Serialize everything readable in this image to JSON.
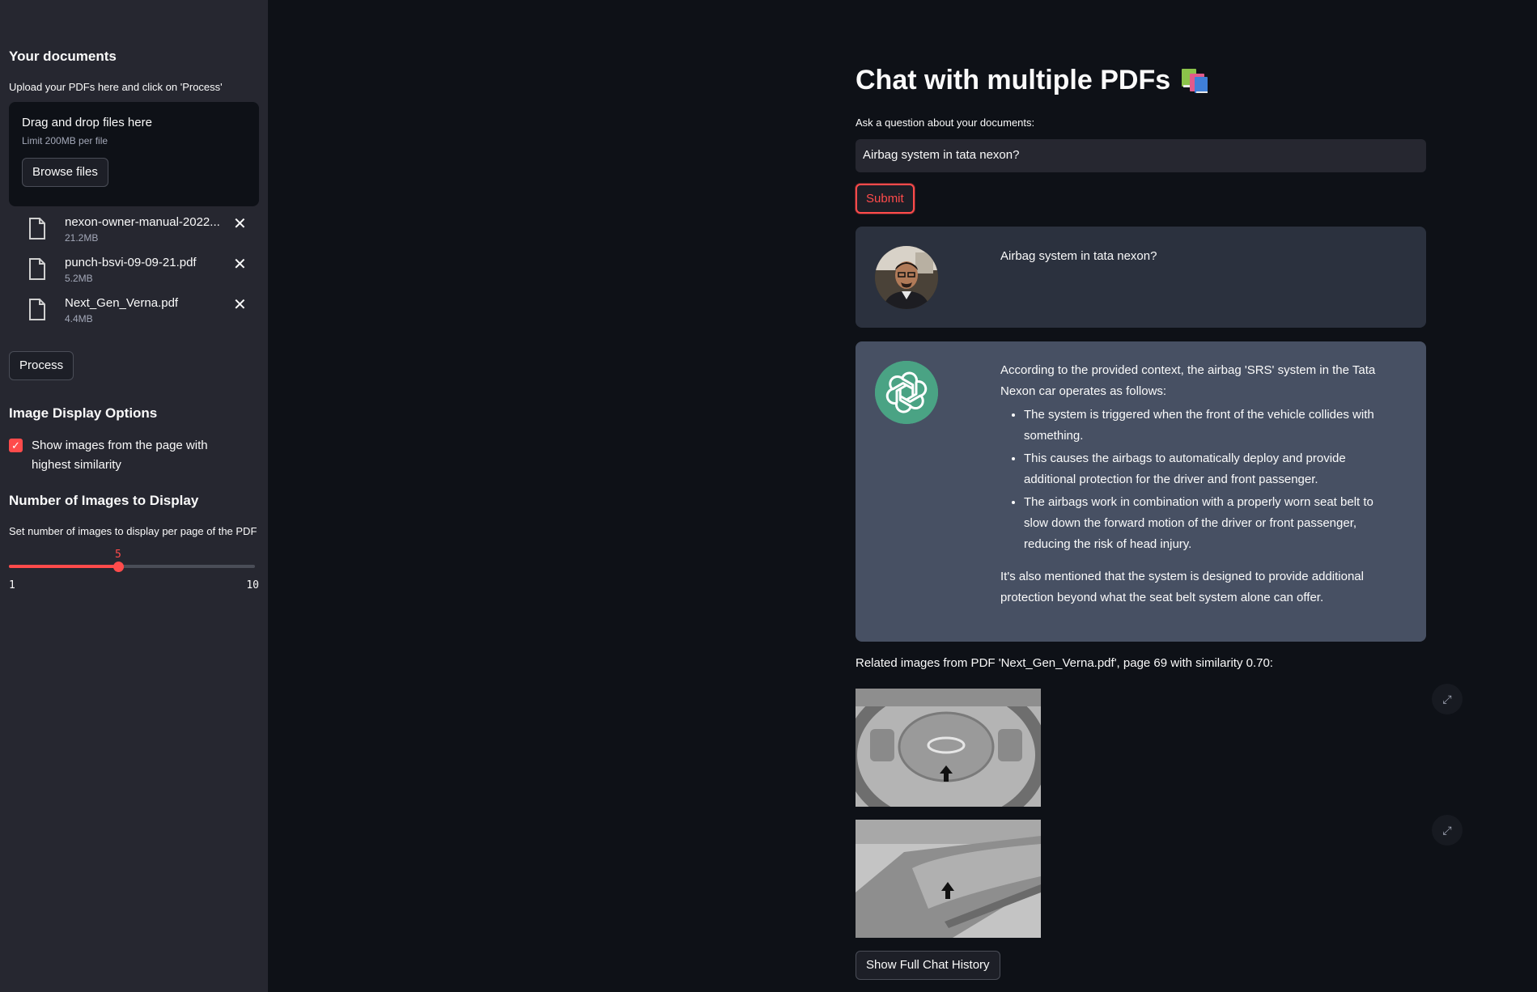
{
  "sidebar": {
    "heading": "Your documents",
    "upload_caption": "Upload your PDFs here and click on 'Process'",
    "dropzone": {
      "title": "Drag and drop files here",
      "limit": "Limit 200MB per file",
      "browse_label": "Browse files"
    },
    "files": [
      {
        "name": "nexon-owner-manual-2022...",
        "size": "21.2MB"
      },
      {
        "name": "punch-bsvi-09-09-21.pdf",
        "size": "5.2MB"
      },
      {
        "name": "Next_Gen_Verna.pdf",
        "size": "4.4MB"
      }
    ],
    "process_label": "Process",
    "image_options_heading": "Image Display Options",
    "show_images_label": "Show images from the page with highest similarity",
    "show_images_checked": true,
    "num_images_heading": "Number of Images to Display",
    "slider": {
      "caption": "Set number of images to display per page of the PDF",
      "value": "5",
      "min": "1",
      "max": "10"
    }
  },
  "main": {
    "title": "Chat with multiple PDFs",
    "title_icon": "books-icon",
    "question_label": "Ask a question about your documents:",
    "question_value": "Airbag system in tata nexon?",
    "submit_label": "Submit",
    "user_message": "Airbag system in tata nexon?",
    "bot_message": {
      "intro": "According to the provided context, the airbag 'SRS' system in the Tata Nexon car operates as follows:",
      "bullets": [
        "The system is triggered when the front of the vehicle collides with something.",
        "This causes the airbags to automatically deploy and provide additional protection for the driver and front passenger.",
        "The airbags work in combination with a properly worn seat belt to slow down the forward motion of the driver or front passenger, reducing the risk of head injury."
      ],
      "outro": "It's also mentioned that the system is designed to provide additional protection beyond what the seat belt system alone can offer."
    },
    "related_caption": "Related images from PDF 'Next_Gen_Verna.pdf', page 69 with similarity 0.70:",
    "history_label": "Show Full Chat History"
  },
  "colors": {
    "accent": "#ff4b4b",
    "background": "#0e1117",
    "sidebar": "#262730",
    "user_msg_bg": "#2b313e",
    "bot_msg_bg": "#475063",
    "bot_avatar": "#4aa384"
  }
}
